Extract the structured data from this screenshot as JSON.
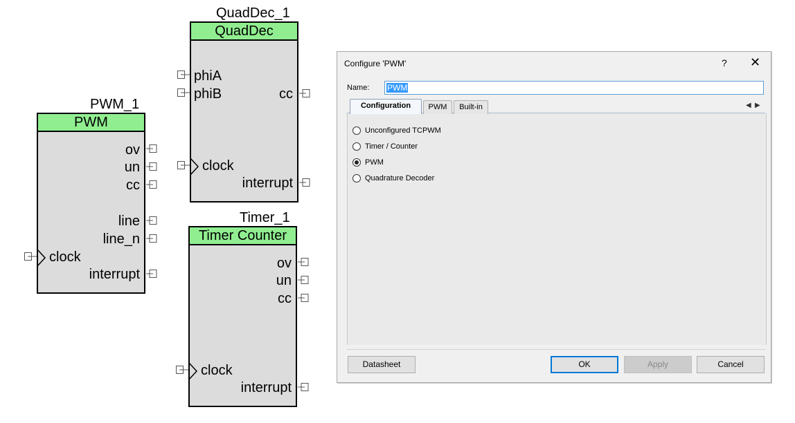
{
  "schematic": {
    "pwm": {
      "instance": "PWM_1",
      "type": "PWM",
      "outputs": [
        "ov",
        "un",
        "cc",
        "line",
        "line_n"
      ],
      "clock": "clock",
      "interrupt": "interrupt"
    },
    "quaddec": {
      "instance": "QuadDec_1",
      "type": "QuadDec",
      "inputs": [
        "phiA",
        "phiB"
      ],
      "output": "cc",
      "clock": "clock",
      "interrupt": "interrupt"
    },
    "timer": {
      "instance": "Timer_1",
      "type": "Timer Counter",
      "outputs": [
        "ov",
        "un",
        "cc"
      ],
      "clock": "clock",
      "interrupt": "interrupt"
    },
    "colors": {
      "header": "#90ee90",
      "body": "#dcdcdc"
    }
  },
  "dialog": {
    "title": "Configure 'PWM'",
    "help": "?",
    "close": "✕",
    "name_label": "Name:",
    "name_value": "PWM",
    "tabs": [
      "Configuration",
      "PWM",
      "Built-in"
    ],
    "active_tab": "Configuration",
    "options": [
      {
        "label": "Unconfigured TCPWM",
        "checked": false
      },
      {
        "label": "Timer / Counter",
        "checked": false
      },
      {
        "label": "PWM",
        "checked": true
      },
      {
        "label": "Quadrature Decoder",
        "checked": false
      }
    ],
    "buttons": {
      "datasheet": "Datasheet",
      "ok": "OK",
      "apply": "Apply",
      "cancel": "Cancel"
    },
    "accent": "#0078d7"
  }
}
